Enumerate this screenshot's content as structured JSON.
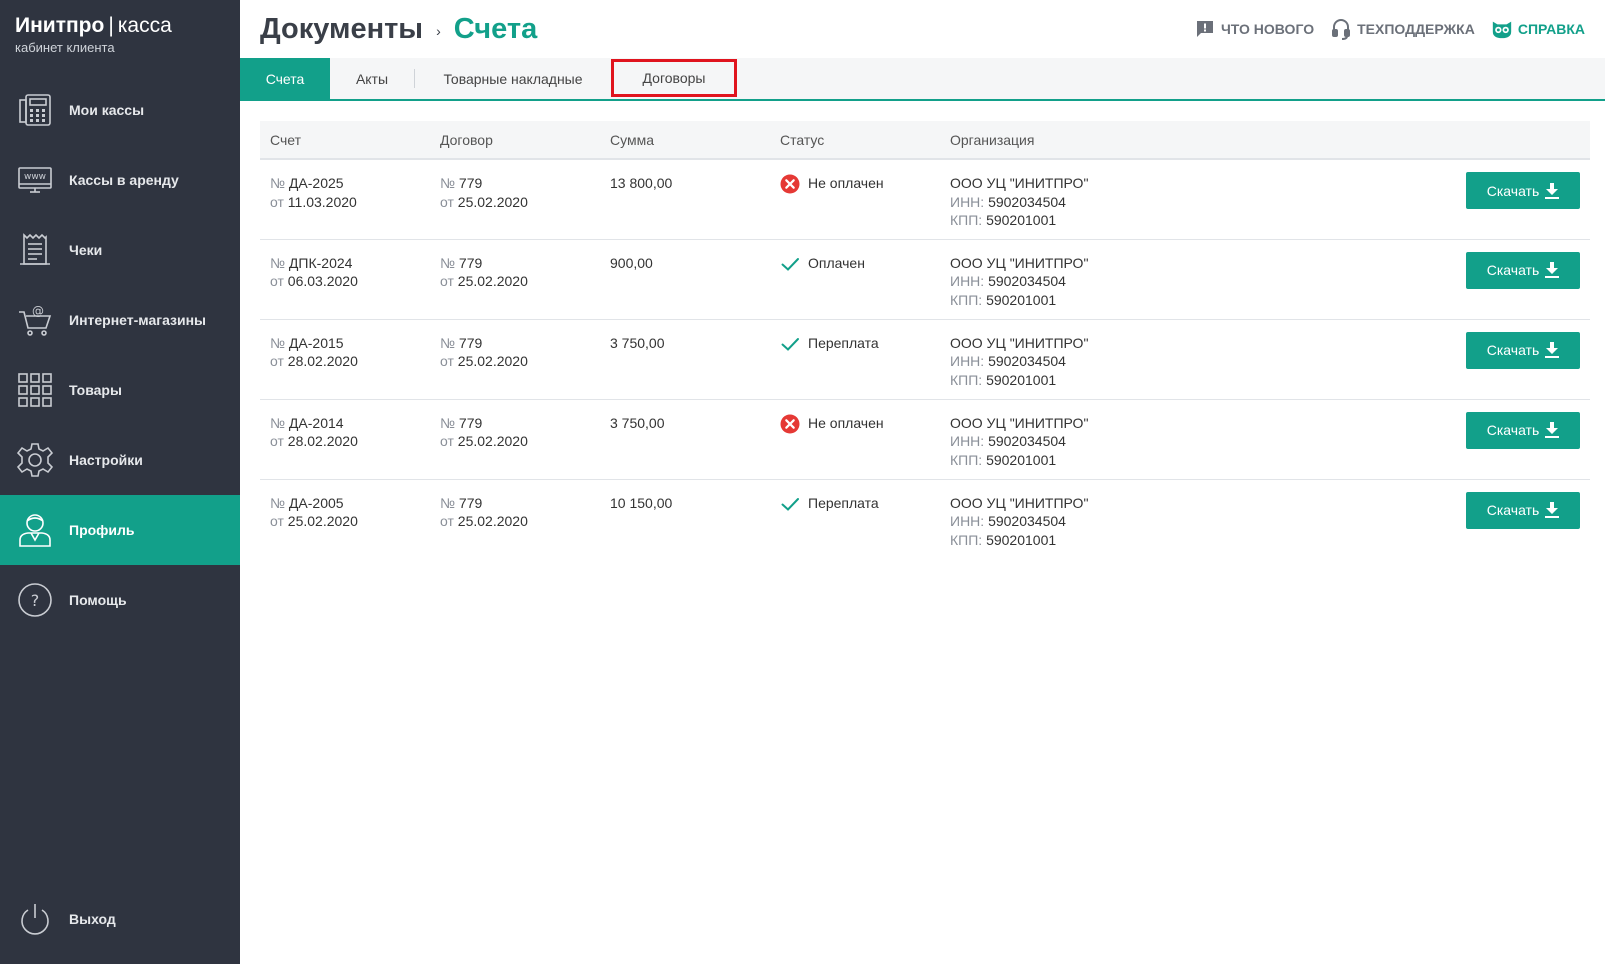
{
  "brand": {
    "name": "Инитпро",
    "separator": "|",
    "product": "касса",
    "subtitle": "кабинет клиента"
  },
  "sidebar": {
    "items": [
      {
        "label": "Мои кассы",
        "icon": "cash-register-icon"
      },
      {
        "label": "Кассы в аренду",
        "icon": "www-monitor-icon"
      },
      {
        "label": "Чеки",
        "icon": "receipt-icon"
      },
      {
        "label": "Интернет-магазины",
        "icon": "cart-at-icon"
      },
      {
        "label": "Товары",
        "icon": "grid-icon"
      },
      {
        "label": "Настройки",
        "icon": "gear-icon"
      },
      {
        "label": "Профиль",
        "icon": "user-icon",
        "active": true
      },
      {
        "label": "Помощь",
        "icon": "question-icon"
      }
    ],
    "logout_label": "Выход"
  },
  "header": {
    "breadcrumb_root": "Документы",
    "breadcrumb_arrow": "›",
    "breadcrumb_current": "Счета",
    "links": {
      "whats_new": "ЧТО НОВОГО",
      "support": "ТЕХПОДДЕРЖКА",
      "help": "СПРАВКА"
    }
  },
  "tabs": [
    {
      "label": "Счета",
      "active": true
    },
    {
      "label": "Акты"
    },
    {
      "label": "Товарные накладные"
    },
    {
      "label": "Договоры",
      "highlighted": true
    }
  ],
  "table": {
    "columns": [
      "Счет",
      "Договор",
      "Сумма",
      "Статус",
      "Организация"
    ],
    "no_prefix": "№",
    "date_prefix": "от",
    "inn_label": "ИНН:",
    "kpp_label": "КПП:",
    "download_label": "Скачать",
    "rows": [
      {
        "invoice_no": "ДА-2025",
        "invoice_date": "11.03.2020",
        "contract_no": "779",
        "contract_date": "25.02.2020",
        "amount": "13 800,00",
        "status": "Не оплачен",
        "status_type": "unpaid",
        "org": "ООО УЦ \"ИНИТПРО\"",
        "inn": "5902034504",
        "kpp": "590201001"
      },
      {
        "invoice_no": "ДПК-2024",
        "invoice_date": "06.03.2020",
        "contract_no": "779",
        "contract_date": "25.02.2020",
        "amount": "900,00",
        "status": "Оплачен",
        "status_type": "paid",
        "org": "ООО УЦ \"ИНИТПРО\"",
        "inn": "5902034504",
        "kpp": "590201001"
      },
      {
        "invoice_no": "ДА-2015",
        "invoice_date": "28.02.2020",
        "contract_no": "779",
        "contract_date": "25.02.2020",
        "amount": "3 750,00",
        "status": "Переплата",
        "status_type": "paid",
        "org": "ООО УЦ \"ИНИТПРО\"",
        "inn": "5902034504",
        "kpp": "590201001"
      },
      {
        "invoice_no": "ДА-2014",
        "invoice_date": "28.02.2020",
        "contract_no": "779",
        "contract_date": "25.02.2020",
        "amount": "3 750,00",
        "status": "Не оплачен",
        "status_type": "unpaid",
        "org": "ООО УЦ \"ИНИТПРО\"",
        "inn": "5902034504",
        "kpp": "590201001"
      },
      {
        "invoice_no": "ДА-2005",
        "invoice_date": "25.02.2020",
        "contract_no": "779",
        "contract_date": "25.02.2020",
        "amount": "10 150,00",
        "status": "Переплата",
        "status_type": "paid",
        "org": "ООО УЦ \"ИНИТПРО\"",
        "inn": "5902034504",
        "kpp": "590201001"
      }
    ]
  },
  "colors": {
    "accent": "#12a08a",
    "sidebar_bg": "#2f3440",
    "error": "#e53935",
    "highlight_frame": "#e0141e"
  }
}
